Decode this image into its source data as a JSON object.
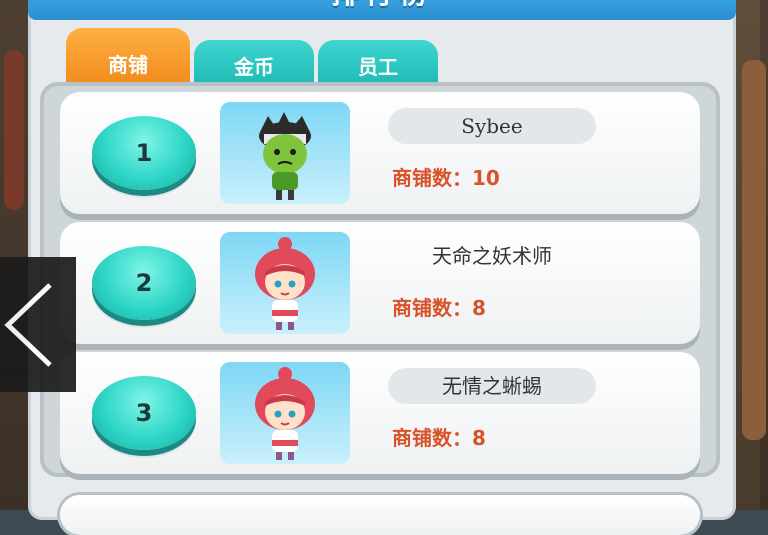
{
  "header": {
    "title": "排行榜"
  },
  "tabs": [
    {
      "label": "商铺",
      "active": true
    },
    {
      "label": "金币",
      "active": false
    },
    {
      "label": "员工",
      "active": false
    }
  ],
  "leaderboard": [
    {
      "rank": "1",
      "name": "Sybee",
      "count_label": "商铺数：",
      "count": "10",
      "avatar": "green-hero-icon"
    },
    {
      "rank": "2",
      "name": "天命之妖术师",
      "count_label": "商铺数：",
      "count": "8",
      "avatar": "pink-hair-girl-icon"
    },
    {
      "rank": "3",
      "name": "无情之蜥蜴",
      "count_label": "商铺数：",
      "count": "8",
      "avatar": "pink-hair-girl-icon"
    }
  ],
  "nav": {
    "back_icon": "chevron-left-icon"
  },
  "colors": {
    "accent_tab": "#f08a1a",
    "tab_inactive": "#1fb9b3",
    "count_text": "#d9532a",
    "title_bar": "#2d8fd0"
  }
}
